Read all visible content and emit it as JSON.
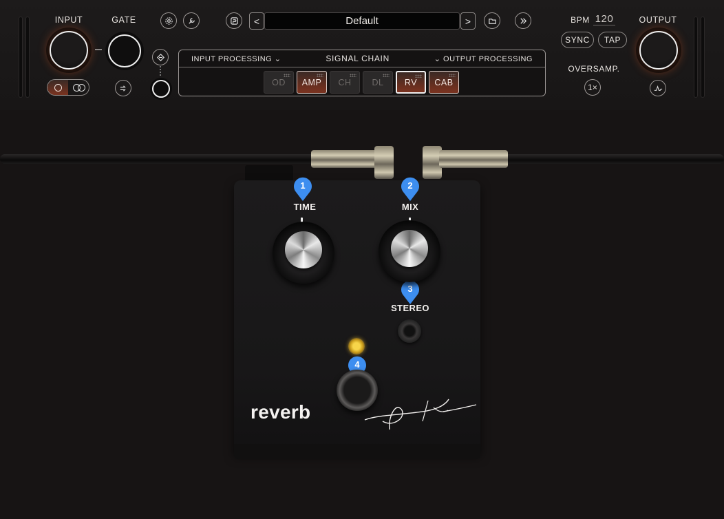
{
  "header": {
    "input_label": "INPUT",
    "gate_label": "GATE",
    "preset_name": "Default",
    "preset_prev": "<",
    "preset_next": ">",
    "bpm_label": "BPM",
    "bpm_value": "120",
    "sync_label": "SYNC",
    "tap_label": "TAP",
    "oversamp_label": "OVERSAMP.",
    "oversamp_value": "1×",
    "output_label": "OUTPUT"
  },
  "signal_chain": {
    "input_processing": "INPUT PROCESSING ⌄",
    "title": "SIGNAL CHAIN",
    "output_processing": "⌄ OUTPUT PROCESSING",
    "slots": [
      {
        "label": "OD",
        "active": false
      },
      {
        "label": "AMP",
        "active": true
      },
      {
        "label": "CH",
        "active": false
      },
      {
        "label": "DL",
        "active": false
      },
      {
        "label": "RV",
        "active": true,
        "selected": true
      },
      {
        "label": "CAB",
        "active": true
      }
    ]
  },
  "pedal": {
    "name": "reverb",
    "controls": {
      "time_label": "TIME",
      "mix_label": "MIX",
      "stereo_label": "STEREO"
    },
    "badges": [
      "1",
      "2",
      "3",
      "4"
    ]
  },
  "colors": {
    "accent": "#e0602a",
    "badge": "#3d8ef0",
    "background": "#171515",
    "led": "#f1c232"
  },
  "icons": [
    "settings-icon",
    "wrench-icon",
    "preset-icon",
    "folder-icon",
    "logo-icon",
    "tuner-icon",
    "phase-icon",
    "output-eq-icon"
  ]
}
